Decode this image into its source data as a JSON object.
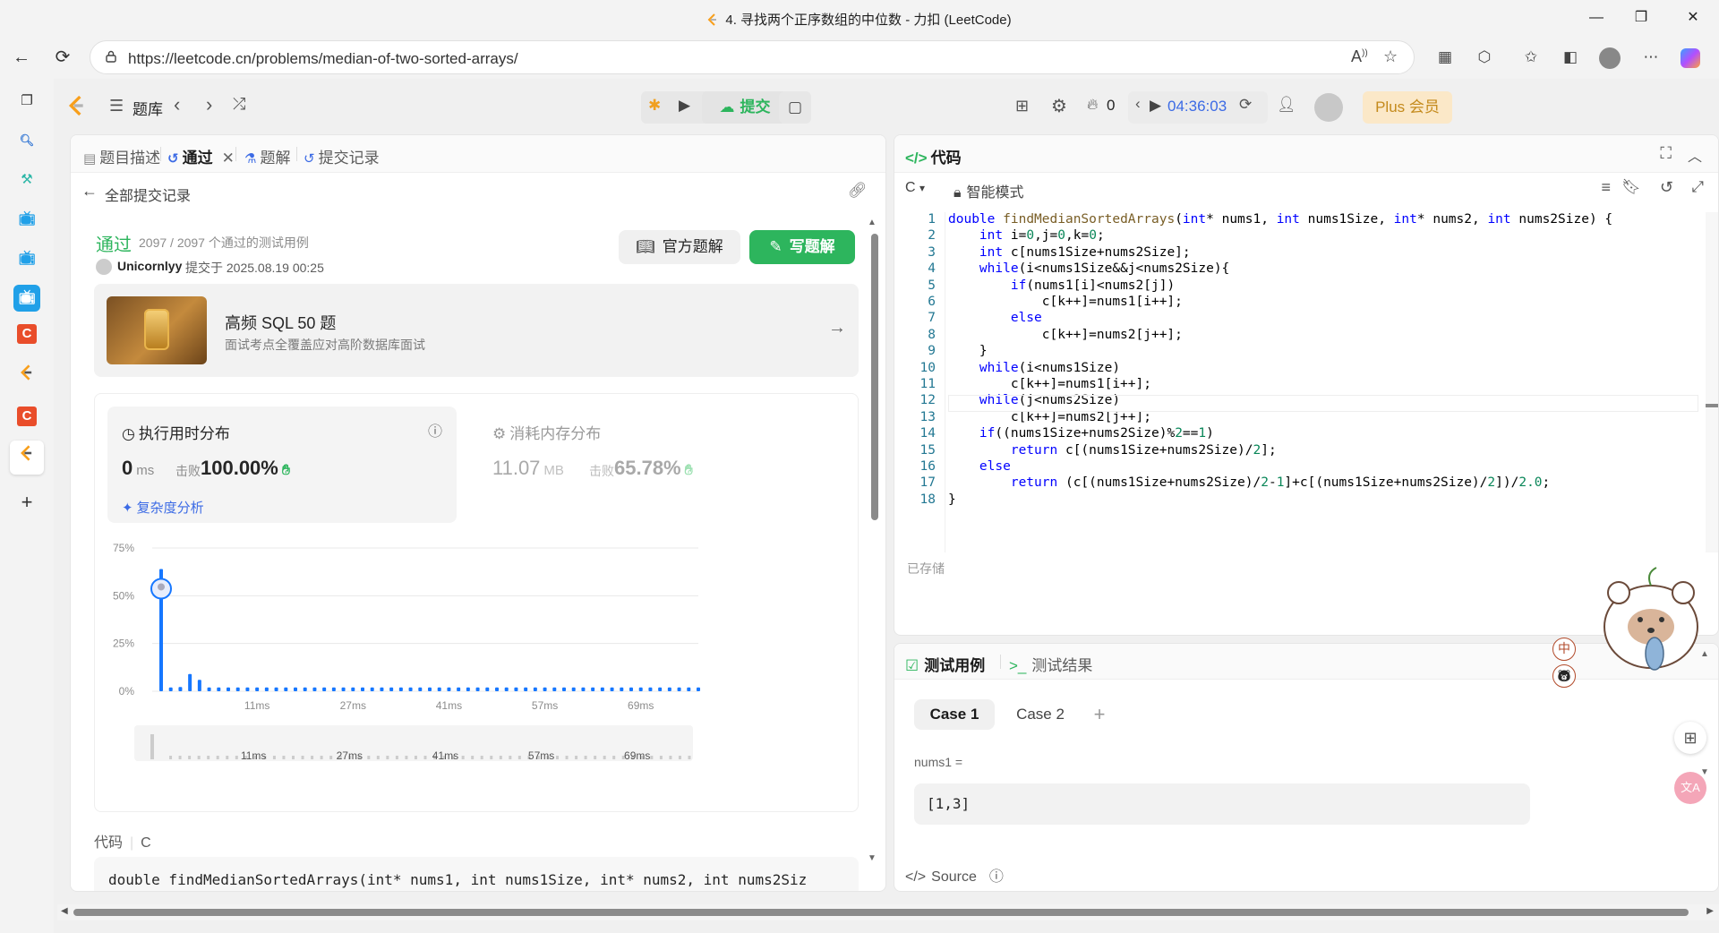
{
  "window": {
    "title": "4. 寻找两个正序数组的中位数 - 力扣 (LeetCode)",
    "minimize": "—",
    "maximize": "❐",
    "close": "✕"
  },
  "browser": {
    "url": "https://leetcode.cn/problems/median-of-two-sorted-arrays/",
    "back": "←",
    "refresh": "⟳",
    "lock": "🔒"
  },
  "nav": {
    "problem_list": "题库",
    "submit": "提交",
    "streak": "0",
    "timer": "04:36:03",
    "plus": "Plus 会员"
  },
  "left_tabs": [
    {
      "label": "题目描述"
    },
    {
      "label": "通过"
    },
    {
      "label": "题解"
    },
    {
      "label": "提交记录"
    }
  ],
  "submission": {
    "back_label": "全部提交记录",
    "status": "通过",
    "passed_tests": "2097 / 2097 个通过的测试用例",
    "author": "Unicornlyy",
    "submitted_at": "提交于 2025.08.19 00:25",
    "official_solution_btn": "官方题解",
    "write_solution_btn": "写题解"
  },
  "promo": {
    "title": "高频 SQL 50 题",
    "subtitle": "面试考点全覆盖应对高阶数据库面试"
  },
  "runtime": {
    "title": "执行用时分布",
    "value": "0",
    "unit": "ms",
    "beat_label": "击败",
    "beat_pct": "100.00%",
    "complexity_link": "复杂度分析"
  },
  "memory": {
    "title": "消耗内存分布",
    "value": "11.07",
    "unit": "MB",
    "beat_label": "击败",
    "beat_pct": "65.78%"
  },
  "chart_data": {
    "type": "bar",
    "ylim": [
      0,
      75
    ],
    "y_ticks": [
      "75%",
      "50%",
      "25%",
      "0%"
    ],
    "x_ticks": [
      "11ms",
      "27ms",
      "41ms",
      "57ms",
      "69ms"
    ],
    "values": [
      64,
      2,
      2.2,
      9,
      6,
      2,
      2,
      2,
      2,
      2,
      2,
      2,
      2,
      2,
      2,
      2,
      2,
      2,
      2,
      2,
      2,
      2,
      2,
      2,
      2,
      2,
      2,
      2,
      2,
      2,
      2,
      2,
      2,
      2,
      2,
      2,
      2,
      2,
      2,
      2,
      2,
      2,
      2,
      2,
      2,
      2,
      2,
      2,
      2,
      2,
      2,
      2,
      2,
      2,
      2,
      2,
      2
    ],
    "mini_x_ticks": [
      "11ms",
      "27ms",
      "41ms",
      "57ms",
      "69ms"
    ],
    "color": "#1677ff"
  },
  "code_preview": {
    "header": "代码",
    "lang": "C",
    "line": "double findMedianSortedArrays(int* nums1, int nums1Size, int* nums2, int nums2Siz"
  },
  "code_panel": {
    "title": "代码",
    "lang": "C",
    "mode": "智能模式",
    "saved": "已存储",
    "lines": [
      "double findMedianSortedArrays(int* nums1, int nums1Size, int* nums2, int nums2Size) {",
      "    int i=0,j=0,k=0;",
      "    int c[nums1Size+nums2Size];",
      "    while(i<nums1Size&&j<nums2Size){",
      "        if(nums1[i]<nums2[j])",
      "            c[k++]=nums1[i++];",
      "        else",
      "            c[k++]=nums2[j++];",
      "    }",
      "    while(i<nums1Size)",
      "        c[k++]=nums1[i++];",
      "    while(j<nums2Size)",
      "        c[k++]=nums2[j++];",
      "    if((nums1Size+nums2Size)%2==1)",
      "        return c[(nums1Size+nums2Size)/2];",
      "    else",
      "        return (c[(nums1Size+nums2Size)/2-1]+c[(nums1Size+nums2Size)/2])/2.0;",
      "}"
    ]
  },
  "test_panel": {
    "tab_cases": "测试用例",
    "tab_results": "测试结果",
    "case1": "Case 1",
    "case2": "Case 2",
    "add": "+",
    "param_label": "nums1 =",
    "param_value": "[1,3]",
    "source": "Source",
    "zh_badge": "中"
  },
  "accent": {
    "green": "#2db55d",
    "blue": "#3c6be5",
    "orange": "#c48a1c"
  }
}
